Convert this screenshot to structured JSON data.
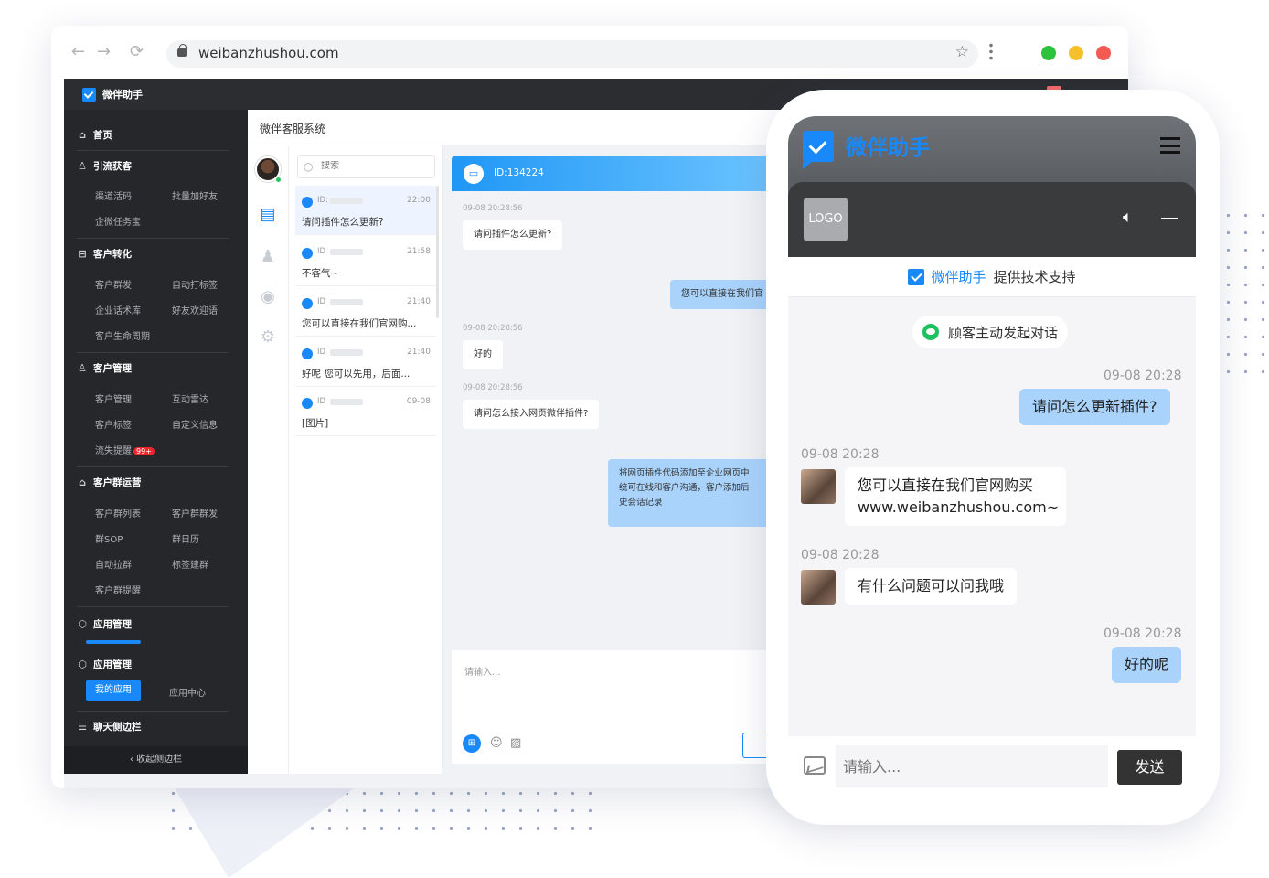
{
  "browser": {
    "url": "weibanzhushou.com",
    "back": "←",
    "forward": "→",
    "reload": "⟳",
    "star": "☆",
    "traffic_colors": [
      "#2dc23d",
      "#f6c02c",
      "#f25a52"
    ]
  },
  "app": {
    "brand": "微伴助手",
    "system_title": "微伴客服系统"
  },
  "sidebar": {
    "groups": [
      {
        "icon": "home-icon",
        "glyph": "⌂",
        "label": "首页",
        "items": []
      },
      {
        "icon": "user-add-icon",
        "glyph": "♙",
        "label": "引流获客",
        "items": [
          "渠道活码",
          "批量加好友",
          "企微任务宝"
        ]
      },
      {
        "icon": "convert-icon",
        "glyph": "⊟",
        "label": "客户转化",
        "items": [
          "客户群发",
          "自动打标签",
          "企业话术库",
          "好友欢迎语",
          "客户生命周期"
        ]
      },
      {
        "icon": "customer-icon",
        "glyph": "♙",
        "label": "客户管理",
        "items": [
          "客户管理",
          "互动雷达",
          "客户标签",
          "自定义信息",
          "流失提醒"
        ]
      },
      {
        "icon": "group-icon",
        "glyph": "⌂",
        "label": "客户群运营",
        "items": [
          "客户群列表",
          "客户群群发",
          "群SOP",
          "群日历",
          "自动拉群",
          "标签建群",
          "客户群提醒"
        ]
      },
      {
        "icon": "app-icon",
        "glyph": "⬡",
        "label": "应用管理",
        "items": []
      },
      {
        "icon": "app-icon",
        "glyph": "⬡",
        "label": "应用管理",
        "items": [
          "我的应用",
          "应用中心"
        ]
      },
      {
        "icon": "sidebar-icon",
        "glyph": "☰",
        "label": "聊天侧边栏",
        "items": []
      }
    ],
    "churn_badge": "99+",
    "collapse": "‹ 收起侧边栏"
  },
  "conversations": {
    "search_placeholder": "搜索",
    "items": [
      {
        "id": "ID:",
        "time": "22:00",
        "msg": "请问插件怎么更新?"
      },
      {
        "id": "ID",
        "time": "21:58",
        "msg": "不客气~"
      },
      {
        "id": "ID",
        "time": "21:40",
        "msg": "您可以直接在我们官网购..."
      },
      {
        "id": "ID",
        "time": "21:40",
        "msg": "好呢 您可以先用，后面..."
      },
      {
        "id": "ID",
        "time": "09-08",
        "msg": "[图片]"
      }
    ]
  },
  "chat": {
    "header_id": "ID:134224",
    "messages": [
      {
        "ts": "09-08 20:28:56",
        "side": "l",
        "text": "请问插件怎么更新?"
      },
      {
        "side": "r",
        "text": "您可以直接在我们官"
      },
      {
        "ts": "09-08 20:28:56",
        "side": "l",
        "text": "好的"
      },
      {
        "ts": "09-08 20:28:56",
        "side": "l",
        "text": "请问怎么接入网页微伴插件?"
      },
      {
        "side": "r",
        "text": "将网页插件代码添加至企业网页中\n统可在线和客户沟通，客户添加后\n史会话记录"
      }
    ],
    "input_placeholder": "请输入..."
  },
  "phone": {
    "title": "微伴助手",
    "logo_text": "LOGO",
    "support_brand": "微伴助手",
    "support_text": "提供技术支持",
    "started": "顾客主动发起对话",
    "messages": [
      {
        "ts": "09-08 20:28",
        "side": "r",
        "text": "请问怎么更新插件?"
      },
      {
        "ts": "09-08 20:28",
        "side": "l",
        "line1": "您可以直接在我们官网购买",
        "line2": "www.weibanzhushou.com~"
      },
      {
        "ts": "09-08 20:28",
        "side": "l",
        "text": "有什么问题可以问我哦"
      },
      {
        "ts": "09-08 20:28",
        "side": "r",
        "text": "好的呢"
      }
    ],
    "input_placeholder": "请输入...",
    "send": "发送"
  }
}
